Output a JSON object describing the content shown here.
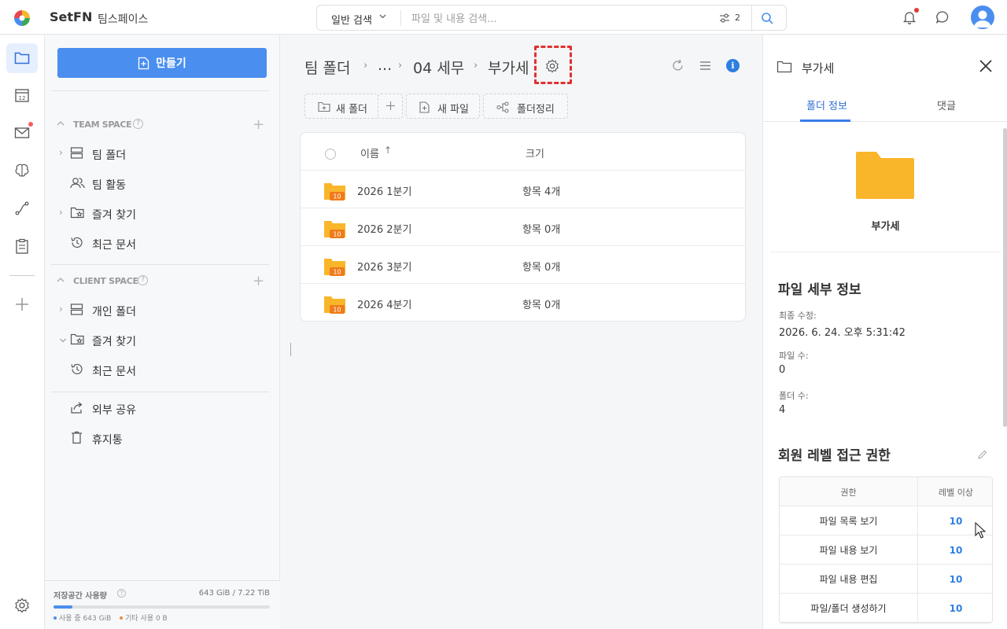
{
  "app": {
    "brand": "SetFN",
    "team_name": "팀스페이스"
  },
  "search": {
    "type_label": "일반 검색",
    "placeholder": "파일 및 내용 검색...",
    "value": "",
    "filter_count": "2"
  },
  "sidebar": {
    "create_label": "만들기",
    "team_space": {
      "header": "TEAM SPACE",
      "items": [
        {
          "label": "팀 폴더",
          "icon": "server-icon"
        },
        {
          "label": "팀 활동",
          "icon": "users-icon"
        },
        {
          "label": "즐겨 찾기",
          "icon": "star-folder-icon"
        },
        {
          "label": "최근 문서",
          "icon": "history-icon"
        }
      ]
    },
    "client_space": {
      "header": "CLIENT SPACE",
      "items": [
        {
          "label": "개인 폴더",
          "icon": "server-icon"
        },
        {
          "label": "즐겨 찾기",
          "icon": "star-folder-icon"
        },
        {
          "label": "최근 문서",
          "icon": "history-icon"
        }
      ]
    },
    "extra": [
      {
        "label": "외부 공유",
        "icon": "share-icon"
      },
      {
        "label": "휴지통",
        "icon": "trash-icon"
      }
    ],
    "storage": {
      "title": "저장공간 사용량",
      "total": "643 GiB / 7.22 TiB",
      "used_label": "사용 중 643 GiB",
      "other_label": "기타 사용 0 B",
      "used_fraction": 0.087,
      "used_color": "#4a8ef0",
      "other_color": "#f08c3a"
    }
  },
  "breadcrumb": {
    "root": "팀 폴더",
    "ellipsis": "...",
    "parent": "04 세무",
    "current": "부가세"
  },
  "toolbar": {
    "new_folder": "새 폴더",
    "new_file": "새 파일",
    "organize": "폴더정리"
  },
  "filelist": {
    "col_name": "이름",
    "col_size": "크기",
    "rows": [
      {
        "name": "2026 1분기",
        "size": "항목 4개",
        "badge": "10"
      },
      {
        "name": "2026 2분기",
        "size": "항목 0개",
        "badge": "10"
      },
      {
        "name": "2026 3분기",
        "size": "항목 0개",
        "badge": "10"
      },
      {
        "name": "2026 4분기",
        "size": "항목 0개",
        "badge": "10"
      }
    ]
  },
  "rpanel": {
    "title": "부가세",
    "tabs": [
      "폴더 정보",
      "댓글"
    ],
    "folder_name": "부가세",
    "details_title": "파일 세부 정보",
    "modified_key": "최종 수정:",
    "modified_val": "2026. 6. 24. 오후 5:31:42",
    "files_key": "파일 수:",
    "files_val": "0",
    "folders_key": "폴더 수:",
    "folders_val": "4",
    "access_title": "회원 레벨 접근 권한",
    "table_head": [
      "권한",
      "레벨 이상"
    ],
    "perms": [
      {
        "name": "파일 목록 보기",
        "level": "10"
      },
      {
        "name": "파일 내용 보기",
        "level": "10"
      },
      {
        "name": "파일 내용 편집",
        "level": "10"
      },
      {
        "name": "파일/폴더 생성하기",
        "level": "10"
      }
    ]
  },
  "colors": {
    "accent": "#4a8ef0",
    "folder": "#f9b62a",
    "badge": "#f07b1a",
    "highlight": "#e03131"
  }
}
